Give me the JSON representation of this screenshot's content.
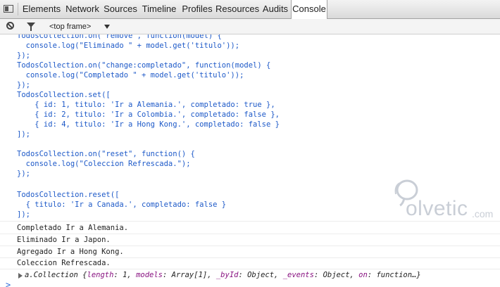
{
  "tabs": [
    "Elements",
    "Network",
    "Sources",
    "Timeline",
    "Profiles",
    "Resources",
    "Audits",
    "Console"
  ],
  "active_tab": "Console",
  "toolbar": {
    "frame": "<top frame>"
  },
  "console": {
    "code": [
      "TodosCollection.on(\"remove\", function(model) {",
      "  console.log(\"Eliminado \" + model.get('titulo'));",
      "});",
      "TodosCollection.on(\"change:completado\", function(model) {",
      "  console.log(\"Completado \" + model.get('titulo'));",
      "});",
      "TodosCollection.set([",
      "    { id: 1, titulo: 'Ir a Alemania.', completado: true },",
      "    { id: 2, titulo: 'Ir a Colombia.', completado: false },",
      "    { id: 4, titulo: 'Ir a Hong Kong.', completado: false }",
      "]);",
      "",
      "TodosCollection.on(\"reset\", function() {",
      "  console.log(\"Coleccion Refrescada.\");",
      "});",
      "",
      "TodosCollection.reset([",
      "  { titulo: 'Ir a Canada.', completado: false }",
      "]);"
    ],
    "logs": [
      "Completado Ir a Alemania.",
      "Eliminado Ir a Japon.",
      "Agregado Ir a Hong Kong.",
      "Coleccion Refrescada."
    ],
    "object": {
      "prefix": "a.Collection {",
      "k1": "length",
      "v1": ": 1, ",
      "k2": "models",
      "v2": ": Array[1], ",
      "k3": "_byId",
      "v3": ": Object, ",
      "k4": "_events",
      "v4": ": Object, ",
      "k5": "on",
      "v5": ": function…}"
    },
    "prompt": ">"
  },
  "watermark": {
    "brand": "olvetic",
    "suffix": ".com"
  },
  "icons": [
    "dock-icon",
    "clear-console-icon",
    "filter-icon",
    "dropdown-arrow-icon",
    "expand-arrow-icon"
  ],
  "colors": {
    "command": "#1d59c8",
    "object_key": "#881280",
    "prompt": "#2f6bd8",
    "watermark": "#c9ced6"
  }
}
